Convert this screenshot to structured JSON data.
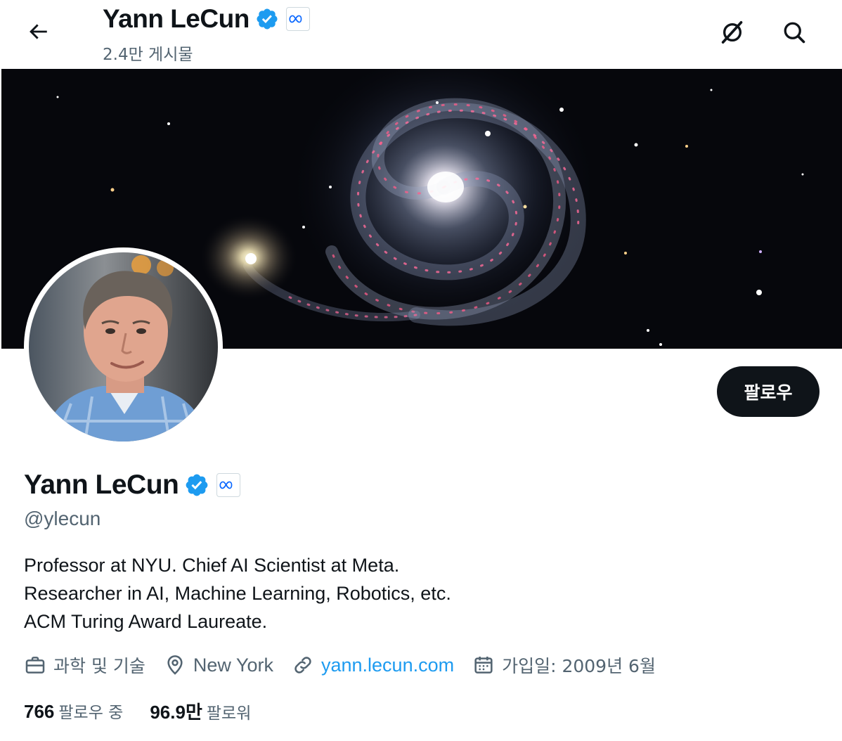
{
  "header": {
    "name": "Yann LeCun",
    "post_count": "2.4만 게시물",
    "icons": {
      "back": "arrow-left-icon",
      "grok": "grok-slash-icon",
      "search": "search-icon"
    }
  },
  "profile": {
    "name": "Yann LeCun",
    "handle": "@ylecun",
    "verified": true,
    "affiliation_badge": "meta-logo-icon",
    "follow_label": "팔로우",
    "bio": [
      "Professor at NYU. Chief AI Scientist at Meta.",
      "Researcher in AI, Machine Learning, Robotics, etc.",
      "ACM Turing Award Laureate."
    ],
    "meta": {
      "category": "과학 및 기술",
      "location": "New York",
      "website": "yann.lecun.com",
      "joined": "가입일: 2009년 6월"
    },
    "stats": {
      "following_count": "766",
      "following_label": "팔로우 중",
      "followers_count": "96.9만",
      "followers_label": "팔로워"
    }
  },
  "colors": {
    "text_primary": "#0f1419",
    "text_secondary": "#536471",
    "link": "#1d9bf0",
    "verified": "#1d9bf0",
    "follow_button_bg": "#0f1419",
    "banner_bg": "#06070c"
  }
}
